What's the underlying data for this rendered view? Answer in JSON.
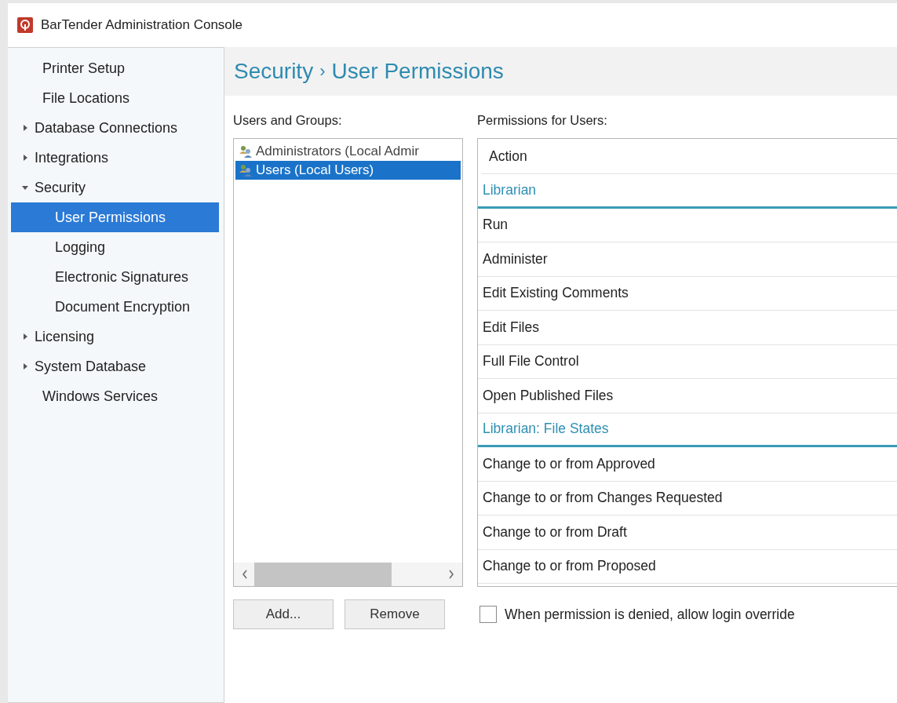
{
  "window": {
    "title": "BarTender Administration Console"
  },
  "sidebar": {
    "items": [
      {
        "label": "Printer Setup",
        "selected": false
      },
      {
        "label": "File Locations",
        "selected": false
      },
      {
        "label": "Database Connections",
        "selected": false,
        "expanded": false
      },
      {
        "label": "Integrations",
        "selected": false,
        "expanded": false
      },
      {
        "label": "Security",
        "selected": false,
        "expanded": true,
        "children": [
          {
            "label": "User Permissions",
            "selected": true
          },
          {
            "label": "Logging",
            "selected": false
          },
          {
            "label": "Electronic Signatures",
            "selected": false
          },
          {
            "label": "Document Encryption",
            "selected": false
          }
        ]
      },
      {
        "label": "Licensing",
        "selected": false,
        "expanded": false
      },
      {
        "label": "System Database",
        "selected": false,
        "expanded": false
      },
      {
        "label": "Windows Services",
        "selected": false
      }
    ]
  },
  "header": {
    "section": "Security",
    "separator": "›",
    "page": "User Permissions"
  },
  "users": {
    "label": "Users and Groups:",
    "items": [
      {
        "name": "Administrators (Local Admir",
        "selected": false
      },
      {
        "name": "Users (Local Users)",
        "selected": true
      }
    ]
  },
  "permissions": {
    "label": "Permissions for Users:",
    "column": "Action",
    "rows": [
      {
        "kind": "group",
        "label": "Librarian"
      },
      {
        "kind": "action",
        "label": "Run"
      },
      {
        "kind": "action",
        "label": "Administer"
      },
      {
        "kind": "action",
        "label": "Edit Existing Comments"
      },
      {
        "kind": "action",
        "label": "Edit Files"
      },
      {
        "kind": "action",
        "label": "Full File Control"
      },
      {
        "kind": "action",
        "label": "Open Published Files"
      },
      {
        "kind": "group",
        "label": "Librarian: File States"
      },
      {
        "kind": "action",
        "label": "Change to or from Approved"
      },
      {
        "kind": "action",
        "label": "Change to or from Changes Requested"
      },
      {
        "kind": "action",
        "label": "Change to or from Draft"
      },
      {
        "kind": "action",
        "label": "Change to or from Proposed"
      }
    ]
  },
  "buttons": [
    "Add...",
    "Remove"
  ],
  "override": {
    "label": "When permission is denied, allow login override",
    "checked": false
  }
}
